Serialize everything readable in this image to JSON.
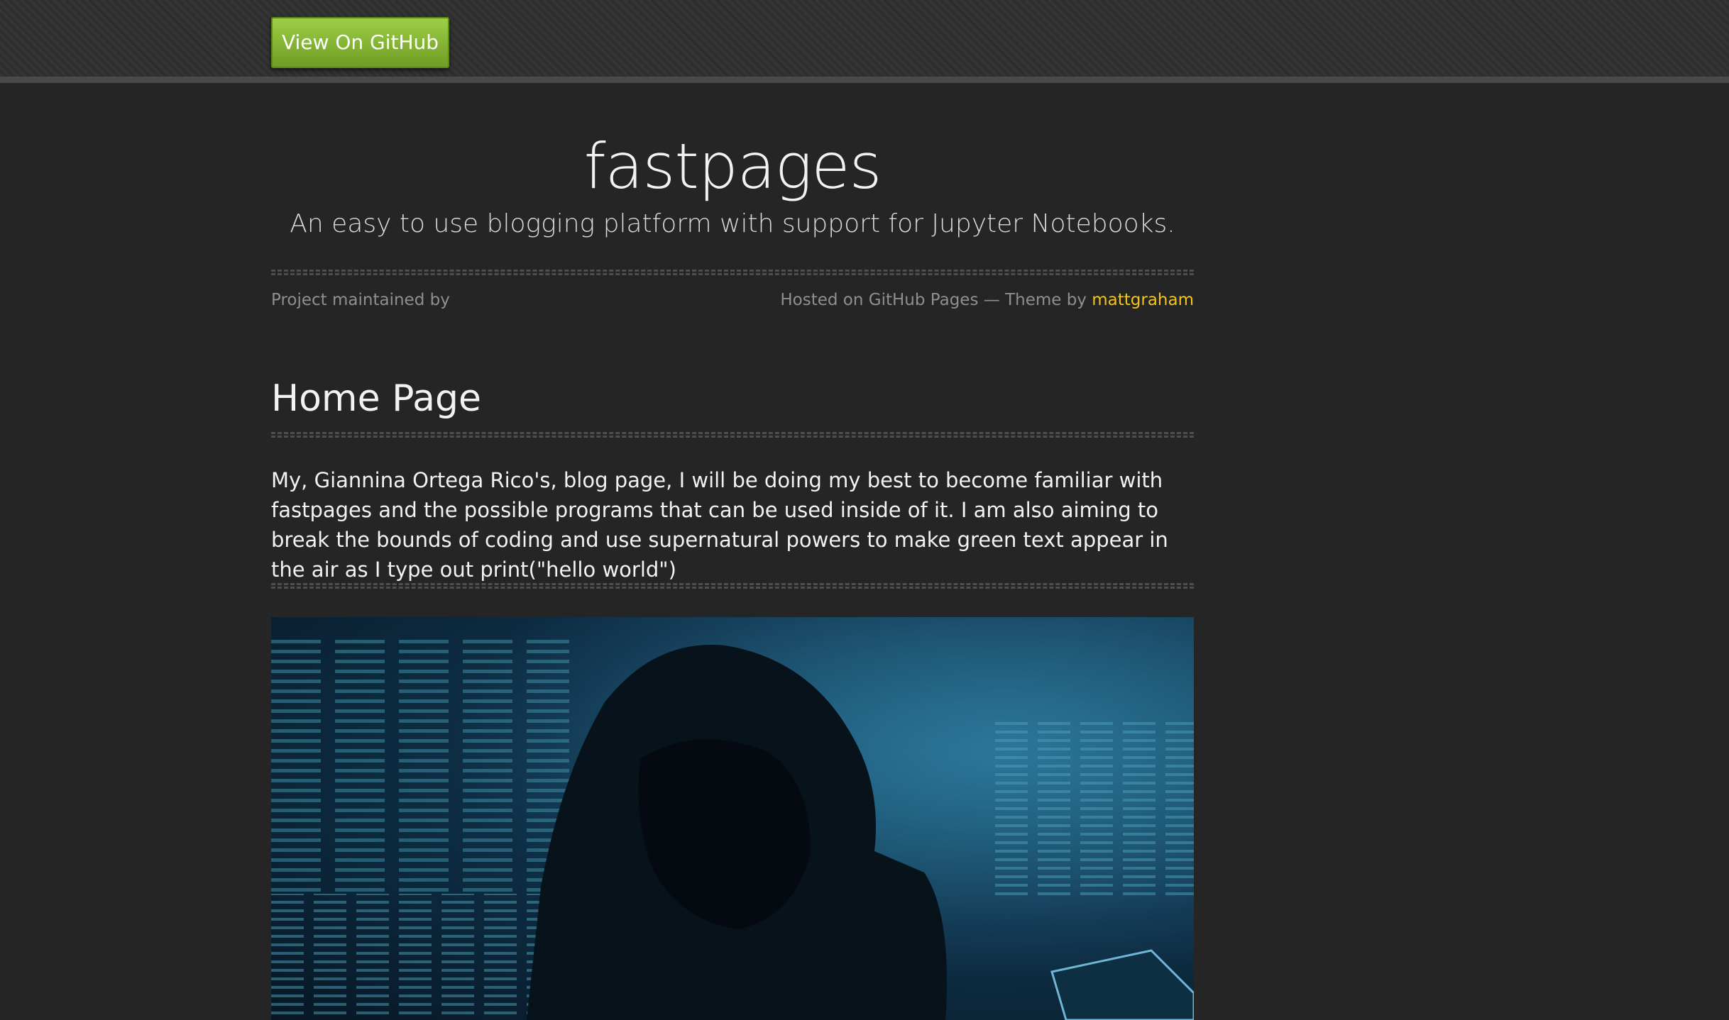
{
  "header": {
    "github_button_label": "View On GitHub"
  },
  "site": {
    "title": "fastpages",
    "tagline": "An easy to use blogging platform with support for Jupyter Notebooks."
  },
  "credits": {
    "maintained_by": "Project maintained by",
    "hosted_on": "Hosted on GitHub Pages — Theme by ",
    "theme_author": "mattgraham"
  },
  "content": {
    "heading": "Home Page",
    "paragraph": "My, Giannina Ortega Rico's, blog page, I will be doing my best to become familiar with fastpages and the possible programs that can be used inside of it. I am also aiming to break the bounds of coding and use supernatural powers to make green text appear in the air as I type out print(\"hello world\")"
  },
  "colors": {
    "page_background": "#252525",
    "button_green": "#7fae33",
    "link_yellow": "#f3c41e"
  }
}
